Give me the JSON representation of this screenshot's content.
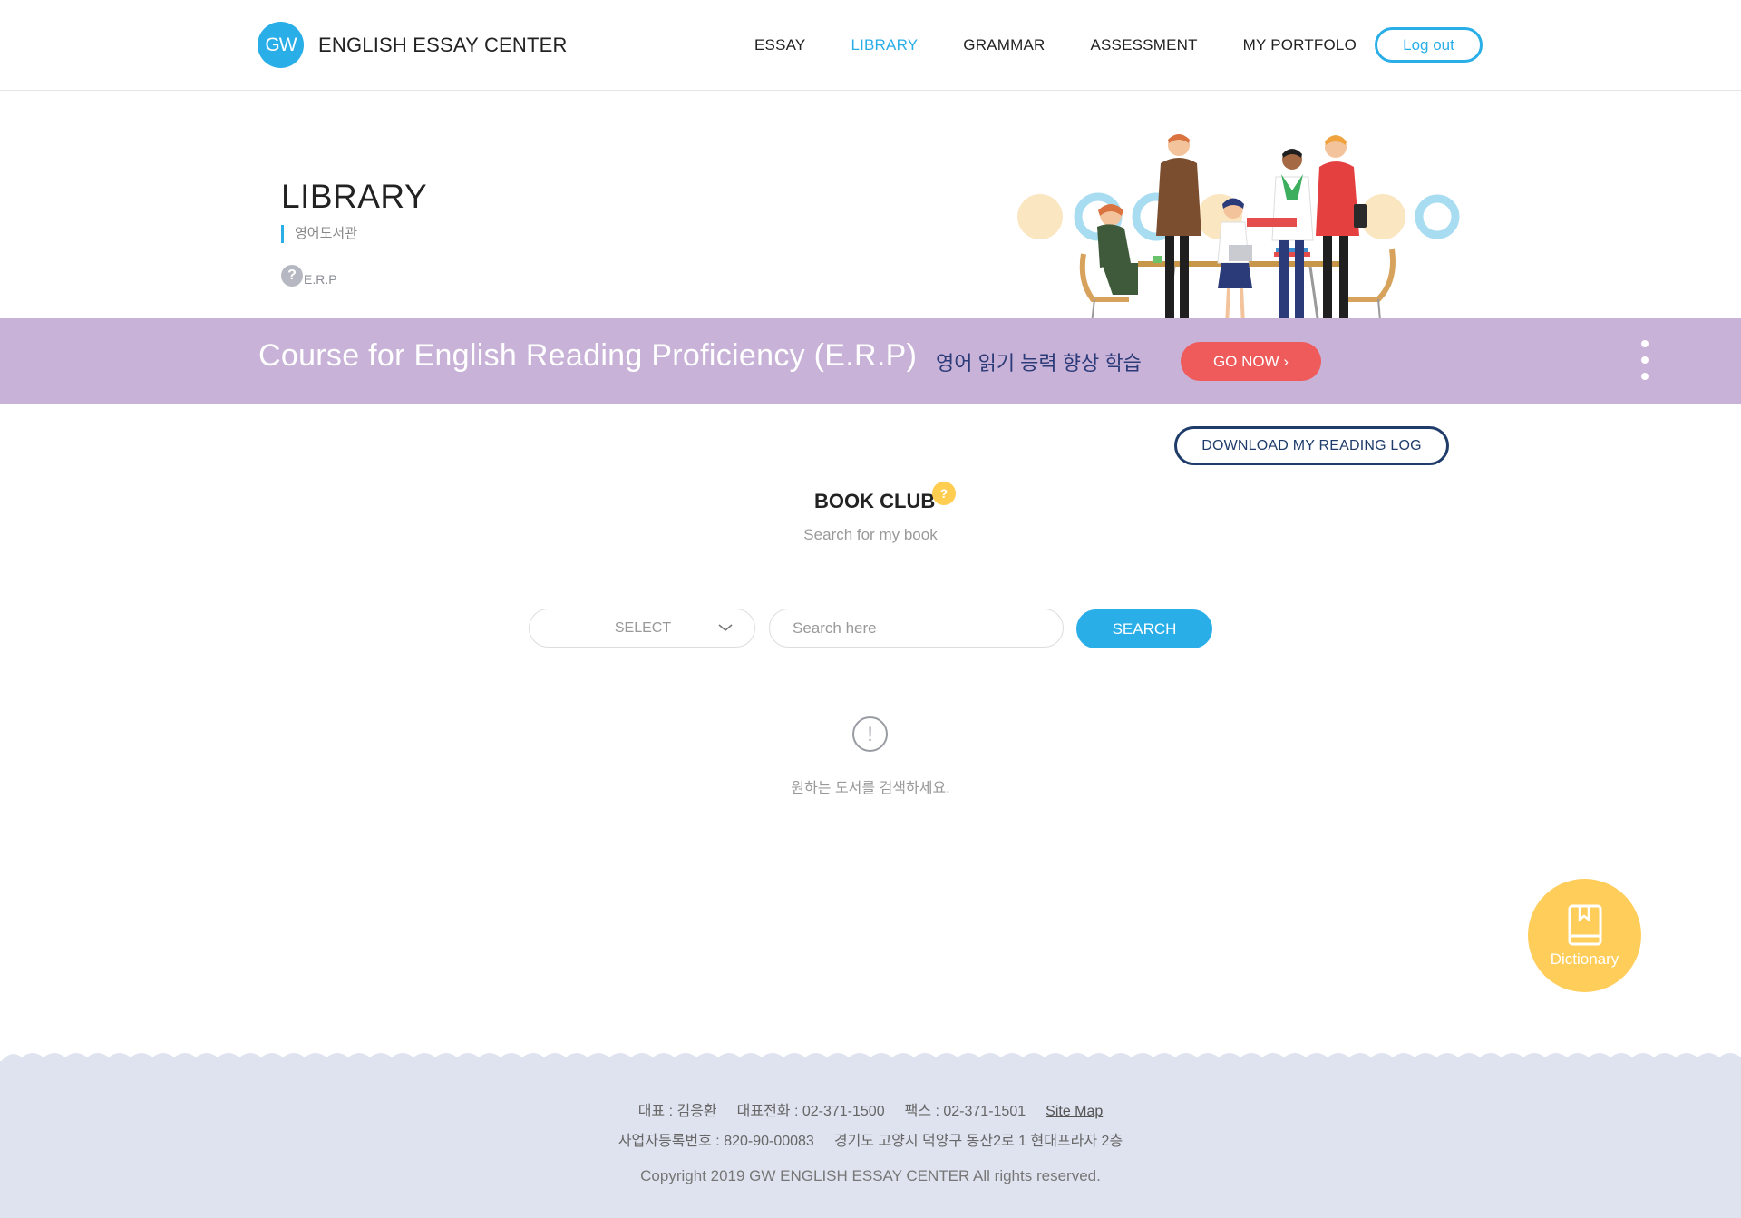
{
  "header": {
    "logo_mark": "GW",
    "brand": "ENGLISH ESSAY CENTER",
    "nav": [
      "ESSAY",
      "LIBRARY",
      "GRAMMAR",
      "ASSESSMENT",
      "MY PORTFOLO"
    ],
    "active_nav": "LIBRARY",
    "logout_label": "Log out"
  },
  "page": {
    "title": "LIBRARY",
    "subtitle": "영어도서관",
    "erp_label": "E.R.P",
    "erp_help_glyph": "?"
  },
  "banner": {
    "title": "Course for English Reading Proficiency (E.R.P)",
    "subtitle": "영어 읽기 능력 향상 학습",
    "go_now_label": "GO NOW ›",
    "background": "#c8b2d8"
  },
  "reading_log": {
    "download_label": "DOWNLOAD MY READING LOG"
  },
  "book_club": {
    "title": "BOOK CLUB",
    "help_glyph": "?",
    "subtitle": "Search for my book"
  },
  "search": {
    "select_label": "SELECT",
    "input_value": "",
    "input_placeholder": "Search here",
    "button_label": "SEARCH"
  },
  "empty_state": {
    "icon_glyph": "!",
    "message": "원하는 도서를 검색하세요."
  },
  "dictionary": {
    "label": "Dictionary"
  },
  "footer": {
    "ceo": "대표 : 김응환",
    "phone": "대표전화 : 02-371-1500",
    "fax": "팩스 : 02-371-1501",
    "sitemap": "Site Map",
    "business_no": "사업자등록번호 : 820-90-00083",
    "address": "경기도 고양시 덕양구 동산2로 1 현대프라자 2층",
    "copyright": "Copyright 2019 GW ENGLISH ESSAY CENTER All rights reserved."
  },
  "colors": {
    "accent": "#29aee8",
    "banner": "#c8b2d8",
    "go_now": "#ef5a5a",
    "dictionary": "#ffcd5a",
    "footer": "#dfe3ef"
  },
  "icons": [
    "chevron-down-icon",
    "help-icon",
    "alert-icon",
    "book-icon",
    "kebab-menu-icon"
  ]
}
